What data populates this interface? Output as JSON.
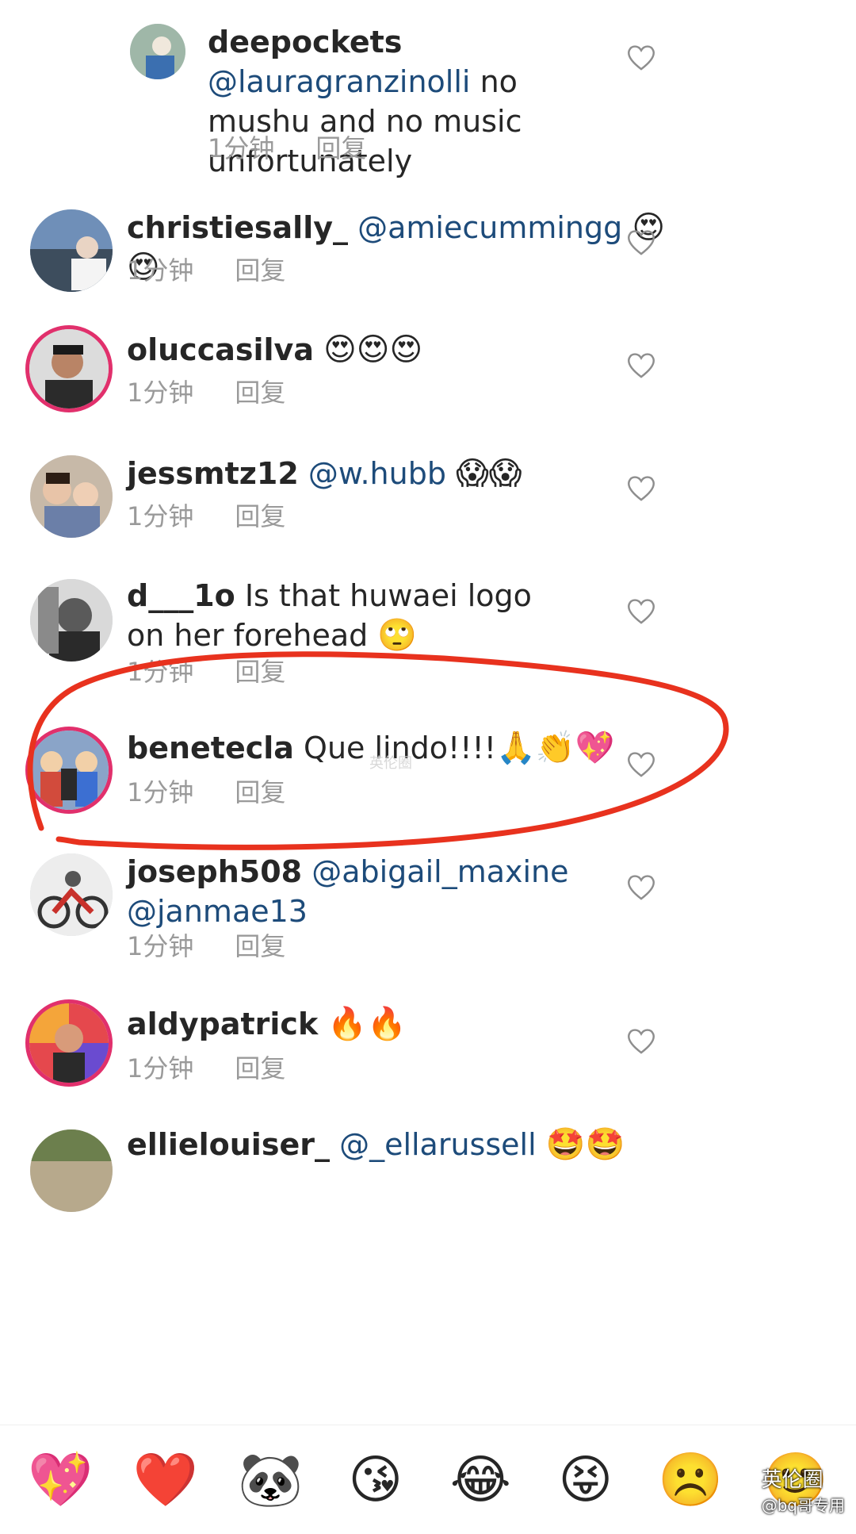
{
  "comments": [
    {
      "username": "deepockets",
      "mention": "@lauragranzinolli",
      "text": "no mushu and no music unfortunately",
      "emoji": "",
      "time": "1分钟",
      "reply": "回复"
    },
    {
      "username": "christiesally_",
      "mention": "@amiecummingg",
      "text": "",
      "emoji": "😍😍",
      "time": "1分钟",
      "reply": "回复"
    },
    {
      "username": "oluccasilva",
      "mention": "",
      "text": "",
      "emoji": "😍😍😍",
      "time": "1分钟",
      "reply": "回复"
    },
    {
      "username": "jessmtz12",
      "mention": "@w.hubb",
      "text": "",
      "emoji": "😱😱",
      "time": "1分钟",
      "reply": "回复"
    },
    {
      "username": "d___1o",
      "mention": "",
      "text": "Is that huwaei logo on her forehead",
      "emoji": "🙄",
      "time": "1分钟",
      "reply": "回复"
    },
    {
      "username": "benetecla",
      "mention": "",
      "text": "Que lindo!!!!",
      "emoji": "🙏👏💖",
      "time": "1分钟",
      "reply": "回复"
    },
    {
      "username": "joseph508",
      "mention": "@abigail_maxine @janmae13",
      "text": "",
      "emoji": "",
      "time": "1分钟",
      "reply": "回复"
    },
    {
      "username": "aldypatrick",
      "mention": "",
      "text": "",
      "emoji": "🔥🔥",
      "time": "1分钟",
      "reply": "回复"
    },
    {
      "username": "ellielouiser_",
      "mention": "@_ellarussell",
      "text": "",
      "emoji": "🤩🤩"
    }
  ],
  "emoji_bar": [
    "💖",
    "❤️",
    "🐼",
    "😘",
    "😂",
    "😝",
    "☹️",
    "🙂"
  ],
  "watermark": "英伦圈",
  "watermark_small": "@bq哥专用",
  "colors": {
    "annotation": "#e8321e",
    "mention": "#1d4b7a",
    "meta": "#9a9a9a"
  }
}
